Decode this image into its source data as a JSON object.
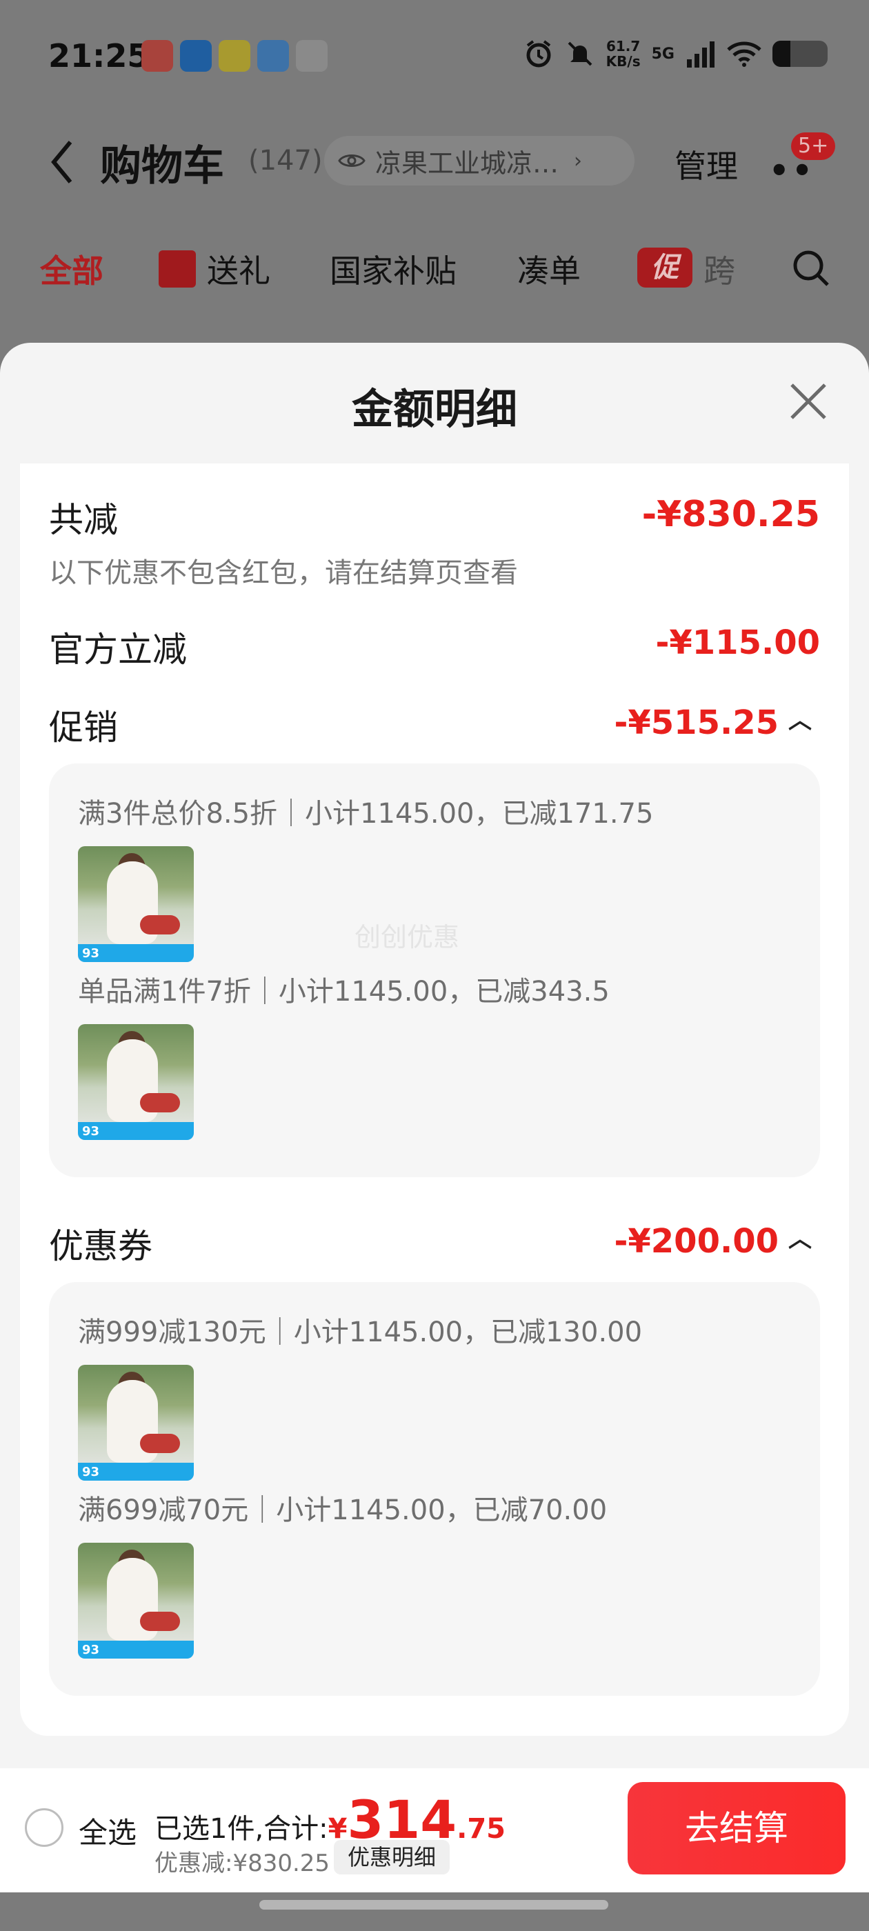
{
  "status_bar": {
    "time": "21:25",
    "net_speed": "61.7",
    "net_unit": "KB/s",
    "signal_label": "5G"
  },
  "header": {
    "title": "购物车",
    "count": "(147)",
    "address": "凉果工业城凉…",
    "manage": "管理",
    "more_badge": "5+"
  },
  "tabs": [
    {
      "label": "全部"
    },
    {
      "label": "送礼"
    },
    {
      "label": "国家补贴"
    },
    {
      "label": "凑单"
    },
    {
      "label": "跨"
    }
  ],
  "promo_tag": "促",
  "sheet": {
    "title": "金额明细",
    "total_label": "共减",
    "total_value": "-¥830.25",
    "total_note": "以下优惠不包含红包，请在结算页查看",
    "official_label": "官方立减",
    "official_value": "-¥115.00",
    "promo_label": "促销",
    "promo_value": "-¥515.25",
    "promo_rules": [
      "满3件总价8.5折｜小计1145.00，已减171.75",
      "单品满1件7折｜小计1145.00，已减343.5"
    ],
    "coupon_label": "优惠券",
    "coupon_value": "-¥200.00",
    "coupon_rules": [
      "满999减130元｜小计1145.00，已减130.00",
      "满699减70元｜小计1145.00，已减70.00"
    ],
    "thumb_badge": "93",
    "watermark": "创创优惠"
  },
  "bottom_bar": {
    "select_all": "全选",
    "summary": "已选1件,合计:",
    "price_symbol": "¥",
    "price_int": "314",
    "price_dec": ".75",
    "discount": "优惠减:¥830.25",
    "detail_button": "优惠明细",
    "checkout": "去结算"
  },
  "colors": {
    "accent_red": "#e8201d",
    "overlay": "#7b7b7b",
    "sheet_bg": "#f4f4f4"
  }
}
